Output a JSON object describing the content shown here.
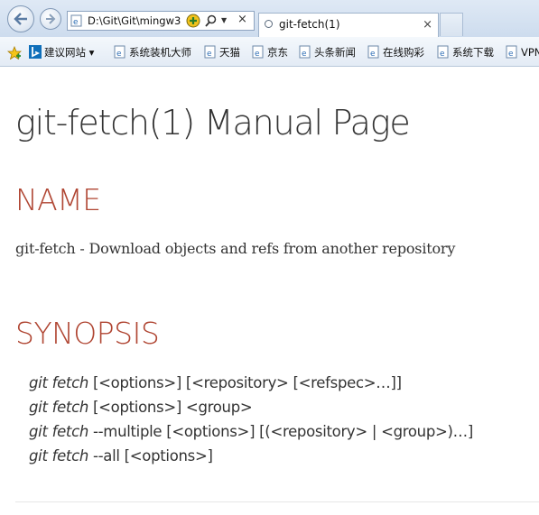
{
  "browser": {
    "address": "D:\\Git\\Git\\mingw3",
    "tab_title": "git-fetch(1)",
    "tab_close": "×",
    "stop_glyph": "×",
    "dropdown_glyph": "▼"
  },
  "favorites": [
    {
      "label": "建议网站 ▾",
      "icon": "bing-icon"
    },
    {
      "label": "系统装机大师",
      "icon": "ie-page-icon"
    },
    {
      "label": "天猫",
      "icon": "ie-page-icon"
    },
    {
      "label": "京东",
      "icon": "ie-page-icon"
    },
    {
      "label": "头条新闻",
      "icon": "ie-page-icon"
    },
    {
      "label": "在线购彩",
      "icon": "ie-page-icon"
    },
    {
      "label": "系统下载",
      "icon": "ie-page-icon"
    },
    {
      "label": "VPN",
      "icon": "ie-page-icon"
    }
  ],
  "page": {
    "title": "git-fetch(1) Manual Page",
    "name_heading": "NAME",
    "name_description": "git-fetch - Download objects and refs from another repository",
    "synopsis_heading": "SYNOPSIS",
    "synopsis": [
      {
        "cmd": "git fetch",
        "args": " [<options>] [<repository> [<refspec>…​]]"
      },
      {
        "cmd": "git fetch",
        "args": " [<options>] <group>"
      },
      {
        "cmd": "git fetch",
        "args": " --multiple [<options>] [(<repository> | <group>)…​]"
      },
      {
        "cmd": "git fetch",
        "args": " --all [<options>]"
      }
    ]
  },
  "colors": {
    "heading_accent": "#b04633",
    "text": "#333333"
  }
}
